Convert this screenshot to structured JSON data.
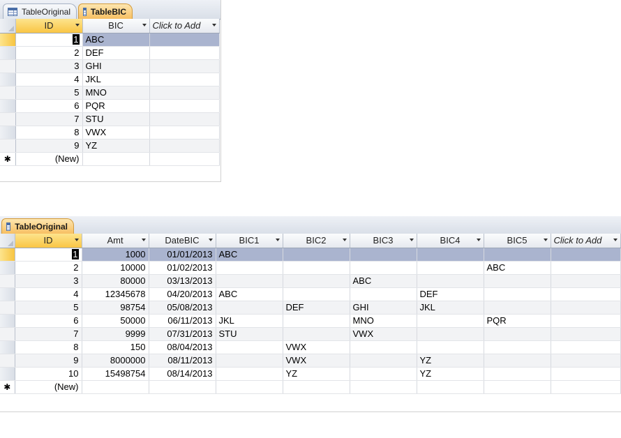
{
  "top_table": {
    "tabs": [
      {
        "label": "TableOriginal",
        "active": false
      },
      {
        "label": "TableBIC",
        "active": true
      }
    ],
    "columns": [
      "ID",
      "BIC",
      "Click to Add"
    ],
    "rows": [
      {
        "id": "1",
        "bic": "ABC"
      },
      {
        "id": "2",
        "bic": "DEF"
      },
      {
        "id": "3",
        "bic": "GHI"
      },
      {
        "id": "4",
        "bic": "JKL"
      },
      {
        "id": "5",
        "bic": "MNO"
      },
      {
        "id": "6",
        "bic": "PQR"
      },
      {
        "id": "7",
        "bic": "STU"
      },
      {
        "id": "8",
        "bic": "VWX"
      },
      {
        "id": "9",
        "bic": "YZ"
      }
    ],
    "new_row_marker": "✱",
    "new_row_label": "(New)"
  },
  "bottom_table": {
    "tab": {
      "label": "TableOriginal",
      "active": true
    },
    "columns": [
      "ID",
      "Amt",
      "DateBIC",
      "BIC1",
      "BIC2",
      "BIC3",
      "BIC4",
      "BIC5",
      "Click to Add"
    ],
    "rows": [
      {
        "id": "1",
        "amt": "1000",
        "date": "01/01/2013",
        "bic1": "ABC",
        "bic2": "",
        "bic3": "",
        "bic4": "",
        "bic5": ""
      },
      {
        "id": "2",
        "amt": "10000",
        "date": "01/02/2013",
        "bic1": "",
        "bic2": "",
        "bic3": "",
        "bic4": "",
        "bic5": "ABC"
      },
      {
        "id": "3",
        "amt": "80000",
        "date": "03/13/2013",
        "bic1": "",
        "bic2": "",
        "bic3": "ABC",
        "bic4": "",
        "bic5": ""
      },
      {
        "id": "4",
        "amt": "12345678",
        "date": "04/20/2013",
        "bic1": "ABC",
        "bic2": "",
        "bic3": "",
        "bic4": "DEF",
        "bic5": ""
      },
      {
        "id": "5",
        "amt": "98754",
        "date": "05/08/2013",
        "bic1": "",
        "bic2": "DEF",
        "bic3": "GHI",
        "bic4": "JKL",
        "bic5": ""
      },
      {
        "id": "6",
        "amt": "50000",
        "date": "06/11/2013",
        "bic1": "JKL",
        "bic2": "",
        "bic3": "MNO",
        "bic4": "",
        "bic5": "PQR"
      },
      {
        "id": "7",
        "amt": "9999",
        "date": "07/31/2013",
        "bic1": "STU",
        "bic2": "",
        "bic3": "VWX",
        "bic4": "",
        "bic5": ""
      },
      {
        "id": "8",
        "amt": "150",
        "date": "08/04/2013",
        "bic1": "",
        "bic2": "VWX",
        "bic3": "",
        "bic4": "",
        "bic5": ""
      },
      {
        "id": "9",
        "amt": "8000000",
        "date": "08/11/2013",
        "bic1": "",
        "bic2": "VWX",
        "bic3": "",
        "bic4": "YZ",
        "bic5": ""
      },
      {
        "id": "10",
        "amt": "15498754",
        "date": "08/14/2013",
        "bic1": "",
        "bic2": "YZ",
        "bic3": "",
        "bic4": "YZ",
        "bic5": ""
      }
    ],
    "new_row_marker": "✱",
    "new_row_label": "(New)"
  },
  "colors": {
    "active_tab": "#f7bf62",
    "selected_column_header": "#f9c544",
    "current_row": "#aab4cf",
    "alternate_row": "#f2f3f5"
  }
}
